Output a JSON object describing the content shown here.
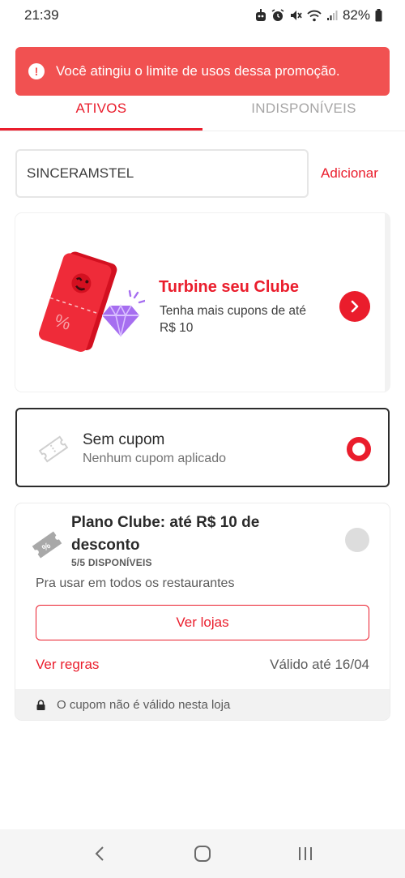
{
  "status_bar": {
    "time": "21:39",
    "battery": "82%",
    "icons": [
      "assistant-icon",
      "alarm-icon",
      "mute-icon",
      "wifi-icon",
      "signal-icon",
      "battery-icon"
    ]
  },
  "toast": {
    "message": "Você atingiu o limite de usos dessa promoção.",
    "icon": "alert-icon",
    "color": "#f15151"
  },
  "tabs": [
    {
      "label": "ATIVOS",
      "active": true
    },
    {
      "label": "INDISPONÍVEIS",
      "active": false
    }
  ],
  "coupon_form": {
    "value": "SINCERAMSTEL",
    "add_label": "Adicionar"
  },
  "promo": {
    "title": "Turbine seu Clube",
    "subtitle": "Tenha mais cupons de até R$ 10"
  },
  "no_coupon": {
    "title": "Sem cupom",
    "subtitle": "Nenhum cupom aplicado",
    "selected": true
  },
  "club_coupon": {
    "title": "Plano Clube: até R$ 10 de desconto",
    "availability": "5/5 DISPONÍVEIS",
    "description": "Pra usar em todos os restaurantes",
    "stores_button": "Ver lojas",
    "rules_link": "Ver regras",
    "validity": "Válido até 16/04",
    "restriction": "O cupom não é válido nesta loja",
    "selected": false
  },
  "theme": {
    "accent": "#ea1d2c",
    "diamond": "#a66ef0"
  }
}
